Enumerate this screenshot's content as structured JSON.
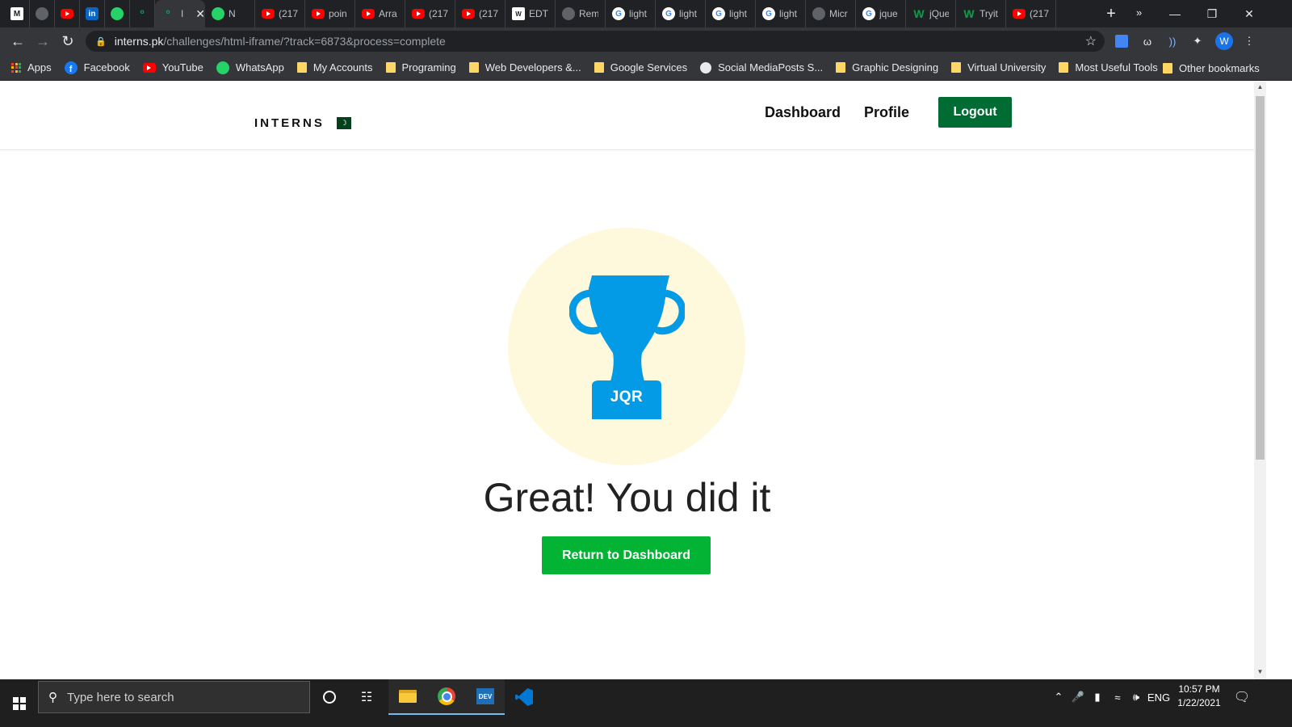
{
  "browser": {
    "tabs": [
      {
        "icon": "gmail-m-icon",
        "title": ""
      },
      {
        "icon": "gray-circle-icon",
        "title": ""
      },
      {
        "icon": "youtube-icon",
        "title": ""
      },
      {
        "icon": "linkedin-icon",
        "title": ""
      },
      {
        "icon": "whatsapp-icon",
        "title": ""
      },
      {
        "icon": "green-swirl-icon",
        "title": ""
      },
      {
        "icon": "green-swirl-icon",
        "title": "I",
        "active": true
      },
      {
        "icon": "meet-icon",
        "title": "N"
      },
      {
        "icon": "youtube-icon",
        "title": "(217"
      },
      {
        "icon": "youtube-icon",
        "title": "poin"
      },
      {
        "icon": "youtube-icon",
        "title": "Arra"
      },
      {
        "icon": "youtube-icon",
        "title": "(217"
      },
      {
        "icon": "youtube-icon",
        "title": "(217"
      },
      {
        "icon": "edt-icon",
        "title": "EDT"
      },
      {
        "icon": "cap-icon",
        "title": "Rem"
      },
      {
        "icon": "google-icon",
        "title": "light"
      },
      {
        "icon": "google-icon",
        "title": "light"
      },
      {
        "icon": "google-icon",
        "title": "light"
      },
      {
        "icon": "google-icon",
        "title": "light"
      },
      {
        "icon": "globe-icon",
        "title": "Micr"
      },
      {
        "icon": "google-icon",
        "title": "jque"
      },
      {
        "icon": "w3schools-icon",
        "title": "jQue"
      },
      {
        "icon": "w3schools-icon",
        "title": "Tryit"
      },
      {
        "icon": "youtube-icon",
        "title": "(217"
      }
    ],
    "url_host": "interns.pk",
    "url_path": "/challenges/html-iframe/?track=6873&process=complete",
    "profile_initial": "W",
    "bookmarks": [
      {
        "type": "apps",
        "label": "Apps"
      },
      {
        "type": "facebook",
        "label": "Facebook"
      },
      {
        "type": "youtube",
        "label": "YouTube"
      },
      {
        "type": "whatsapp",
        "label": "WhatsApp"
      },
      {
        "type": "folder",
        "label": "My Accounts"
      },
      {
        "type": "folder",
        "label": "Programing"
      },
      {
        "type": "folder",
        "label": "Web Developers &..."
      },
      {
        "type": "folder",
        "label": "Google Services"
      },
      {
        "type": "globe",
        "label": "Social MediaPosts S..."
      },
      {
        "type": "folder",
        "label": "Graphic Designing"
      },
      {
        "type": "folder",
        "label": "Virtual University"
      },
      {
        "type": "folder",
        "label": "Most Useful Tools"
      }
    ],
    "bookmarks_more": "»",
    "other_bookmarks": "Other bookmarks"
  },
  "site": {
    "logo_text": "INTERNS",
    "nav": {
      "dashboard": "Dashboard",
      "profile": "Profile",
      "logout": "Logout"
    },
    "trophy_label": "JQR",
    "headline": "Great! You did it",
    "return_button": "Return to Dashboard",
    "colors": {
      "brand_green": "#006b32",
      "button_green": "#02b334",
      "trophy_blue": "#039be5",
      "circle_bg": "#fef9dd"
    }
  },
  "taskbar": {
    "search_placeholder": "Type here to search",
    "language": "ENG",
    "time": "10:57 PM",
    "date": "1/22/2021"
  }
}
